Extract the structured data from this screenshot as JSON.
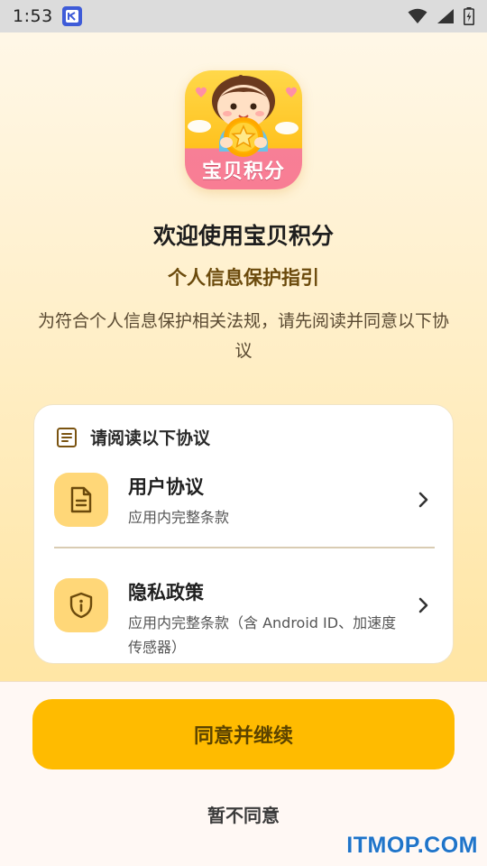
{
  "status_bar": {
    "time": "1:53",
    "icons": [
      "app-notification-icon",
      "wifi-icon",
      "signal-icon",
      "battery-icon"
    ]
  },
  "app": {
    "icon_label": "宝贝积分",
    "title": "欢迎使用宝贝积分",
    "subtitle": "个人信息保护指引",
    "description": "为符合个人信息保护相关法规，请先阅读并同意以下协议"
  },
  "card": {
    "header_label": "请阅读以下协议",
    "header_icon": "document-list-icon",
    "items": [
      {
        "title": "用户协议",
        "subtitle": "应用内完整条款",
        "icon": "document-icon"
      },
      {
        "title": "隐私政策",
        "subtitle": "应用内完整条款（含 Android ID、加速度传感器）",
        "icon": "shield-info-icon"
      }
    ]
  },
  "actions": {
    "agree_label": "同意并继续",
    "decline_label": "暂不同意"
  },
  "watermark": "ITMOP.COM",
  "colors": {
    "primary_button": "#ffbb00",
    "icon_tile": "#ffd778",
    "subtitle_text": "#6b4a0c",
    "watermark": "#1f74c9"
  }
}
